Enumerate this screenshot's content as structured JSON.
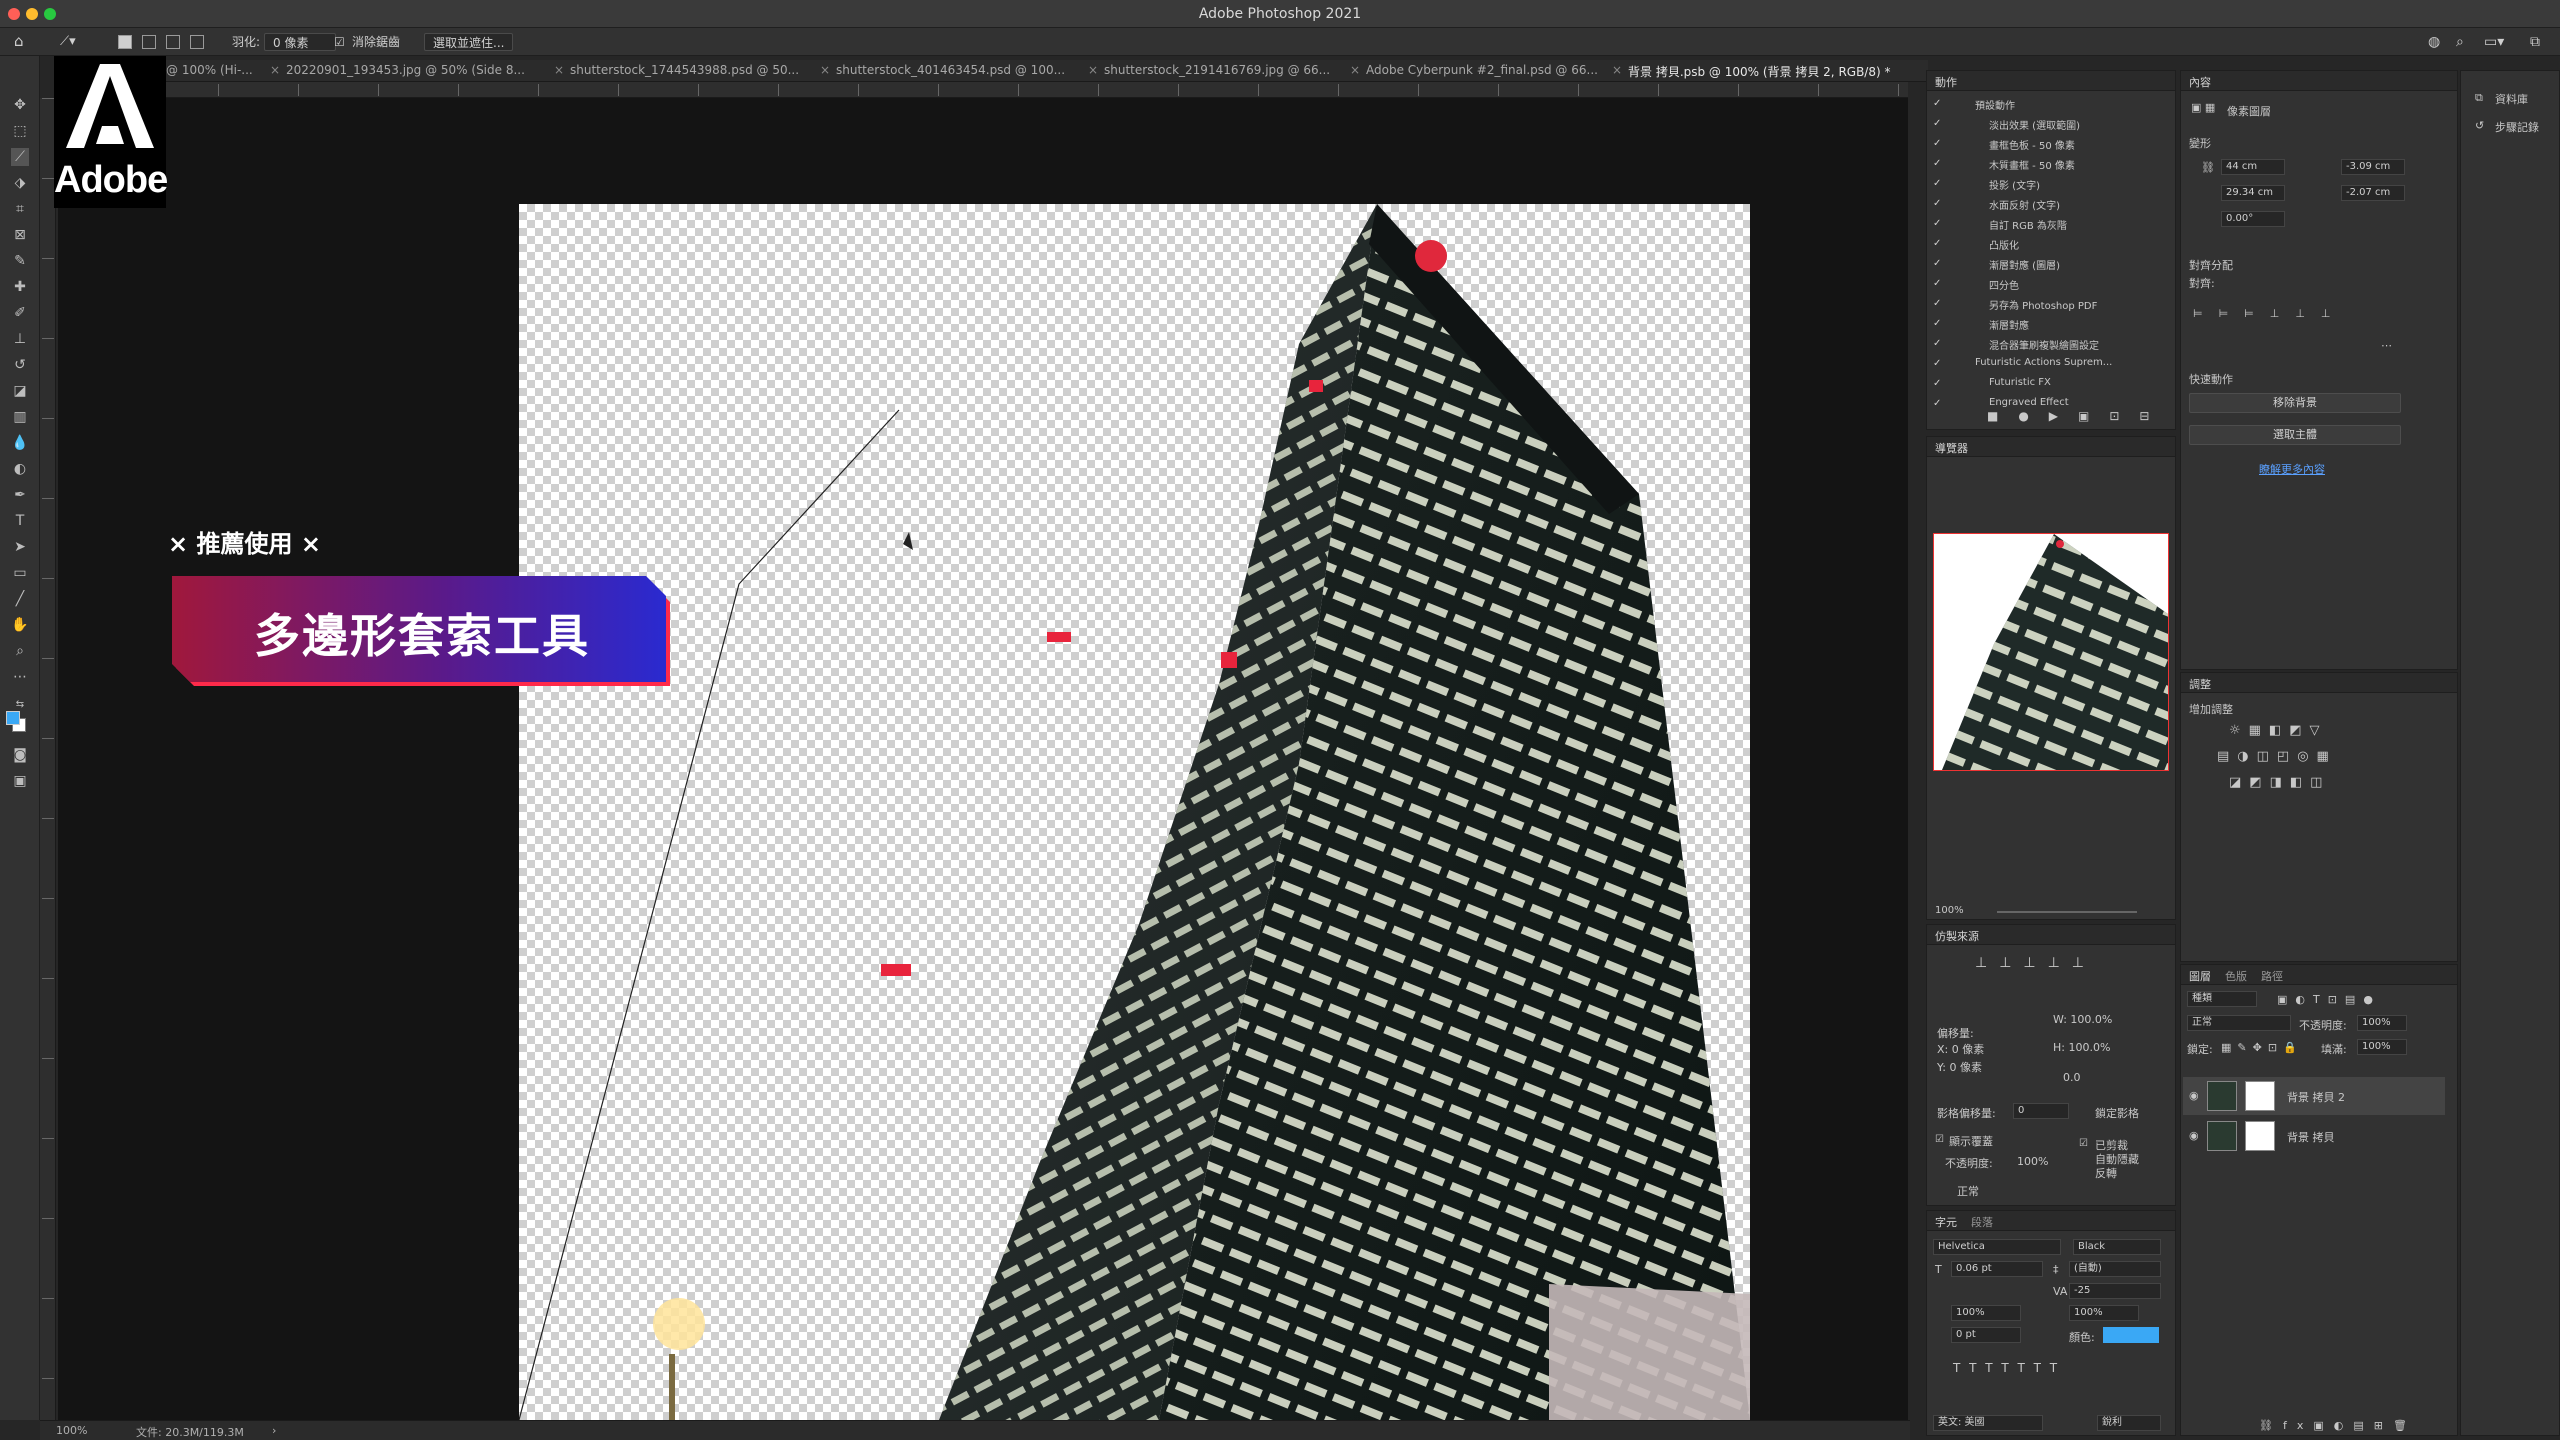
{
  "window": {
    "title": "Adobe Photoshop 2021"
  },
  "options_bar": {
    "feather_label": "羽化:",
    "feather_value": "0 像素",
    "antialias_label": "消除鋸齒",
    "select_mask_label": "選取並遮住..."
  },
  "tabs": [
    {
      "label": "20823...59.psd @ 100% (Hi-..."
    },
    {
      "label": "20220901_193453.jpg @ 50% (Side 8..."
    },
    {
      "label": "shutterstock_1744543988.psd @ 50..."
    },
    {
      "label": "shutterstock_401463454.psd @ 100..."
    },
    {
      "label": "shutterstock_2191416769.jpg @ 66..."
    },
    {
      "label": "Adobe Cyberpunk #2_final.psd @ 66..."
    },
    {
      "label": "背景 拷貝.psb @ 100% (背景 拷貝 2, RGB/8) *"
    }
  ],
  "logo": {
    "word": "Adobe"
  },
  "promo": {
    "subtitle": "× 推薦使用 ×",
    "title": "多邊形套索工具"
  },
  "status": {
    "zoom": "100%",
    "doc": "文件: 20.3M/119.3M"
  },
  "actions_panel": {
    "title": "動作",
    "items": [
      "預設動作",
      "淡出效果 (選取範圍)",
      "畫框色板 - 50 像素",
      "木質畫框 - 50 像素",
      "投影 (文字)",
      "水面反射 (文字)",
      "自訂 RGB 為灰階",
      "凸版化",
      "漸層對應 (圖層)",
      "四分色",
      "另存為 Photoshop PDF",
      "漸層對應",
      "混合器筆刷複製繪圖設定",
      "Futuristic Actions Suprem...",
      "Futuristic FX",
      "Engraved Effect"
    ]
  },
  "navigator_panel": {
    "title": "導覽器",
    "zoom": "100%"
  },
  "clone_source_panel": {
    "title": "仿製來源",
    "offset_label": "偏移量:",
    "x": "X: 0 像素",
    "y": "Y: 0 像素",
    "w": "W: 100.0%",
    "h": "H: 100.0%",
    "angle": "0.0",
    "frame_offset_label": "影格偏移量:",
    "frame_offset": "0",
    "lock_frame": "鎖定影格",
    "show_overlay": "顯示覆蓋",
    "opacity_label": "不透明度:",
    "opacity": "100%",
    "clipped": "已剪裁",
    "auto_hide": "自動隱藏",
    "invert": "反轉",
    "blend": "正常"
  },
  "character_panel": {
    "tabs": [
      "字元",
      "段落"
    ],
    "font": "Helvetica",
    "style": "Black",
    "size": "0.06 pt",
    "leading": "(自動)",
    "kerning": "-25",
    "vscale": "100%",
    "hscale": "100%",
    "baseline": "0 pt",
    "color_label": "顏色:",
    "color": "#3aa8f5",
    "language": "英文: 美國",
    "aa": "銳利"
  },
  "properties_panel": {
    "title": "內容",
    "kind": "像素圖層",
    "transform_label": "變形",
    "w": "44 cm",
    "x": "-3.09 cm",
    "h": "29.34 cm",
    "y": "-2.07 cm",
    "angle": "0.00°",
    "align_label": "對齊分配",
    "align_sub": "對齊:",
    "quick_actions": "快速動作",
    "remove_bg": "移除背景",
    "select_subject": "選取主體",
    "learn_more": "瞭解更多內容"
  },
  "adjustments_panel": {
    "title": "調整",
    "add": "增加調整"
  },
  "layers_panel": {
    "tabs": [
      "圖層",
      "色版",
      "路徑"
    ],
    "kind": "種類",
    "blend": "正常",
    "opacity_label": "不透明度:",
    "opacity": "100%",
    "lock_label": "鎖定:",
    "fill_label": "填滿:",
    "fill": "100%",
    "layers": [
      {
        "name": "背景 拷貝 2"
      },
      {
        "name": "背景 拷貝"
      }
    ]
  },
  "far_right": {
    "item1": "資料庫",
    "item2": "步驟記錄"
  }
}
